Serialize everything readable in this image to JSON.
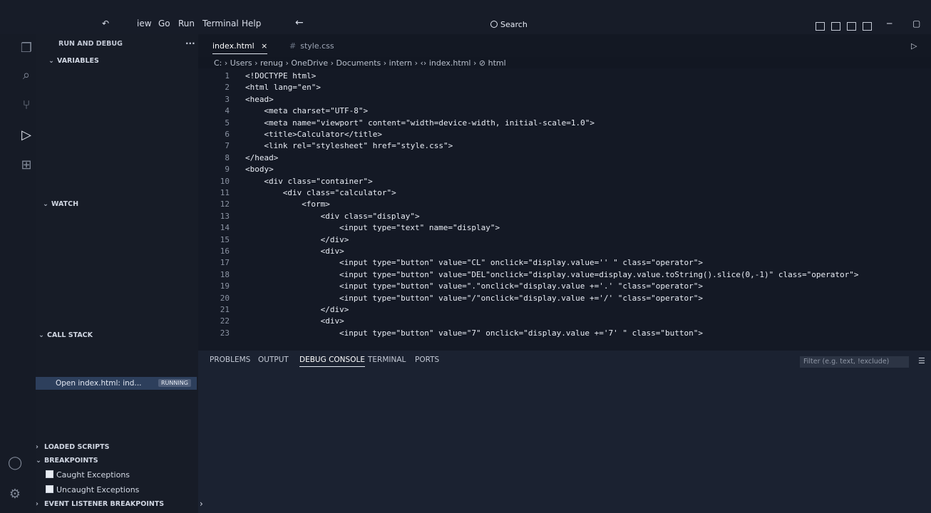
{
  "menu": [
    "iew",
    "Go",
    "Run",
    "Terminal",
    "Help"
  ],
  "search": {
    "label": "Search"
  },
  "sidebar": {
    "title": "RUN AND DEBUG",
    "more": "···",
    "sections": {
      "variables": "VARIABLES",
      "watch": "WATCH",
      "call_stack": "CALL STACK",
      "loaded_scripts": "LOADED SCRIPTS",
      "breakpoints": "BREAKPOINTS",
      "event_listener": "EVENT LISTENER BREAKPOINTS"
    },
    "call_stack_item": {
      "label": "Open index.html: ind...",
      "badge": "RUNNING"
    },
    "breakpoints_items": [
      "Caught Exceptions",
      "Uncaught Exceptions"
    ]
  },
  "tabs": [
    {
      "label": "index.html",
      "close": "×"
    },
    {
      "label": "style.css",
      "icon": "#"
    }
  ],
  "breadcrumb": [
    "C:",
    "Users",
    "renug",
    "OneDrive",
    "Documents",
    "intern",
    "index.html",
    "html"
  ],
  "code_lines": [
    {
      "n": "1",
      "indent": 0,
      "text": "<!DOCTYPE html>"
    },
    {
      "n": "2",
      "indent": 0,
      "text": "<html lang=\"en\">"
    },
    {
      "n": "3",
      "indent": 0,
      "text": "<head>"
    },
    {
      "n": "4",
      "indent": 4,
      "text": "<meta charset=\"UTF-8\">"
    },
    {
      "n": "5",
      "indent": 4,
      "text": "<meta name=\"viewport\" content=\"width=device-width, initial-scale=1.0\">"
    },
    {
      "n": "6",
      "indent": 4,
      "text": "<title>Calculator</title>"
    },
    {
      "n": "7",
      "indent": 4,
      "text": "<link rel=\"stylesheet\" href=\"style.css\">"
    },
    {
      "n": "8",
      "indent": 0,
      "text": "</head>"
    },
    {
      "n": "9",
      "indent": 0,
      "text": "<body>"
    },
    {
      "n": "10",
      "indent": 4,
      "text": "<div class=\"container\">"
    },
    {
      "n": "11",
      "indent": 8,
      "text": "<div class=\"calculator\">"
    },
    {
      "n": "12",
      "indent": 12,
      "text": "<form>"
    },
    {
      "n": "13",
      "indent": 16,
      "text": "<div class=\"display\">"
    },
    {
      "n": "14",
      "indent": 20,
      "text": "<input type=\"text\" name=\"display\">"
    },
    {
      "n": "15",
      "indent": 16,
      "text": "</div>"
    },
    {
      "n": "16",
      "indent": 16,
      "text": "<div>"
    },
    {
      "n": "17",
      "indent": 20,
      "text": "<input type=\"button\" value=\"CL\" onclick=\"display.value='' \" class=\"operator\">"
    },
    {
      "n": "18",
      "indent": 20,
      "text": "<input type=\"button\" value=\"DEL\"onclick=\"display.value=display.value.toString().slice(0,-1)\" class=\"operator\">"
    },
    {
      "n": "19",
      "indent": 20,
      "text": "<input type=\"button\" value=\".\"onclick=\"display.value +='.' \"class=\"operator\">"
    },
    {
      "n": "20",
      "indent": 20,
      "text": "<input type=\"button\" value=\"/\"onclick=\"display.value +='/' \"class=\"operator\">"
    },
    {
      "n": "21",
      "indent": 16,
      "text": "</div>"
    },
    {
      "n": "22",
      "indent": 16,
      "text": "<div>"
    },
    {
      "n": "23",
      "indent": 20,
      "text": "<input type=\"button\" value=\"7\" onclick=\"display.value +='7' \" class=\"button\">"
    }
  ],
  "panel": {
    "tabs": [
      "PROBLEMS",
      "OUTPUT",
      "DEBUG CONSOLE",
      "TERMINAL",
      "PORTS"
    ],
    "active_tab": "DEBUG CONSOLE",
    "filter_placeholder": "Filter (e.g. text, !exclude)",
    "prompt": "›"
  },
  "colors": {
    "accent": "#2d3f5c",
    "background": "#121722"
  }
}
